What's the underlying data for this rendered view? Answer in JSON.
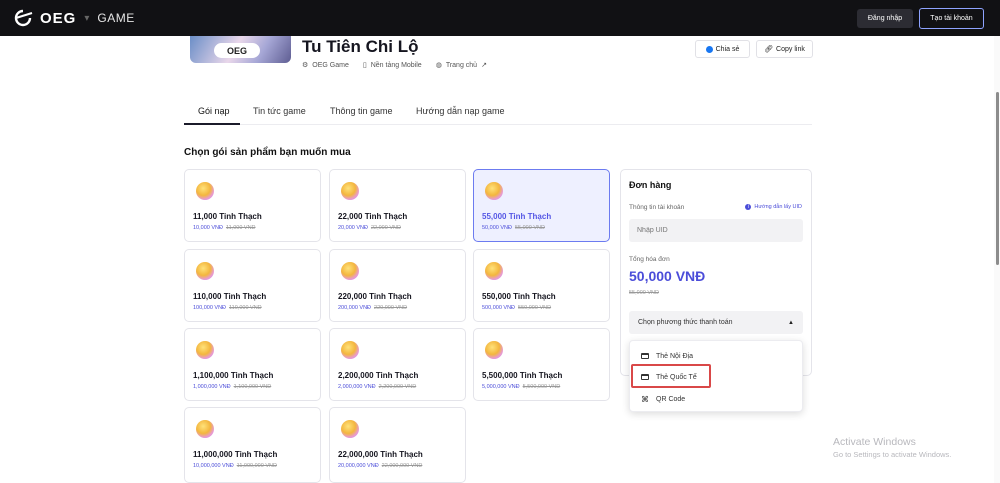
{
  "nav": {
    "brand": "OEG",
    "separator": "▾",
    "section": "GAME",
    "login": "Đăng nhập",
    "signup": "Tạo tài khoản"
  },
  "game": {
    "thumb_logo": "OEG",
    "title": "Tu Tiên Chi Lộ",
    "publisher": "OEG Game",
    "platform": "Nền tảng Mobile",
    "homepage": "Trang chủ",
    "share": "Chia sẻ",
    "copy_link": "Copy link"
  },
  "tabs": [
    "Gói nạp",
    "Tin tức game",
    "Thông tin game",
    "Hướng dẫn nạp game"
  ],
  "section_title": "Chọn gói sản phẩm bạn muốn mua",
  "products": [
    {
      "name": "11,000 Tinh Thạch",
      "price": "10,000 VNĐ",
      "old": "11,000 VNĐ"
    },
    {
      "name": "22,000 Tinh Thạch",
      "price": "20,000 VNĐ",
      "old": "22,000 VNĐ"
    },
    {
      "name": "55,000 Tinh Thạch",
      "price": "50,000 VNĐ",
      "old": "55,000 VNĐ",
      "selected": true
    },
    {
      "name": "110,000 Tinh Thạch",
      "price": "100,000 VNĐ",
      "old": "110,000 VNĐ"
    },
    {
      "name": "220,000 Tinh Thạch",
      "price": "200,000 VNĐ",
      "old": "220,000 VNĐ"
    },
    {
      "name": "550,000 Tinh Thạch",
      "price": "500,000 VNĐ",
      "old": "550,000 VNĐ"
    },
    {
      "name": "1,100,000 Tinh Thạch",
      "price": "1,000,000 VNĐ",
      "old": "1,100,000 VNĐ"
    },
    {
      "name": "2,200,000 Tinh Thạch",
      "price": "2,000,000 VNĐ",
      "old": "2,200,000 VNĐ"
    },
    {
      "name": "5,500,000 Tinh Thạch",
      "price": "5,000,000 VNĐ",
      "old": "5,500,000 VNĐ"
    },
    {
      "name": "11,000,000 Tinh Thạch",
      "price": "10,000,000 VNĐ",
      "old": "11,000,000 VNĐ"
    },
    {
      "name": "22,000,000 Tinh Thạch",
      "price": "20,000,000 VNĐ",
      "old": "22,000,000 VNĐ"
    }
  ],
  "order": {
    "title": "Đơn hàng",
    "account_label": "Thông tin tài khoản",
    "uid_help": "Hướng dẫn lấy UID",
    "uid_placeholder": "Nhập UID",
    "total_label": "Tổng hóa đơn",
    "total": "50,000 VNĐ",
    "total_old": "55,000 VNĐ",
    "payment_placeholder": "Chọn phương thức thanh toán",
    "payment_options": [
      "Thẻ Nội Địa",
      "Thẻ Quốc Tế",
      "QR Code"
    ]
  },
  "watermark": {
    "line1": "Activate Windows",
    "line2": "Go to Settings to activate Windows."
  },
  "colors": {
    "accent": "#4b4dd9",
    "topbar": "#111114",
    "highlight": "#d94848"
  }
}
